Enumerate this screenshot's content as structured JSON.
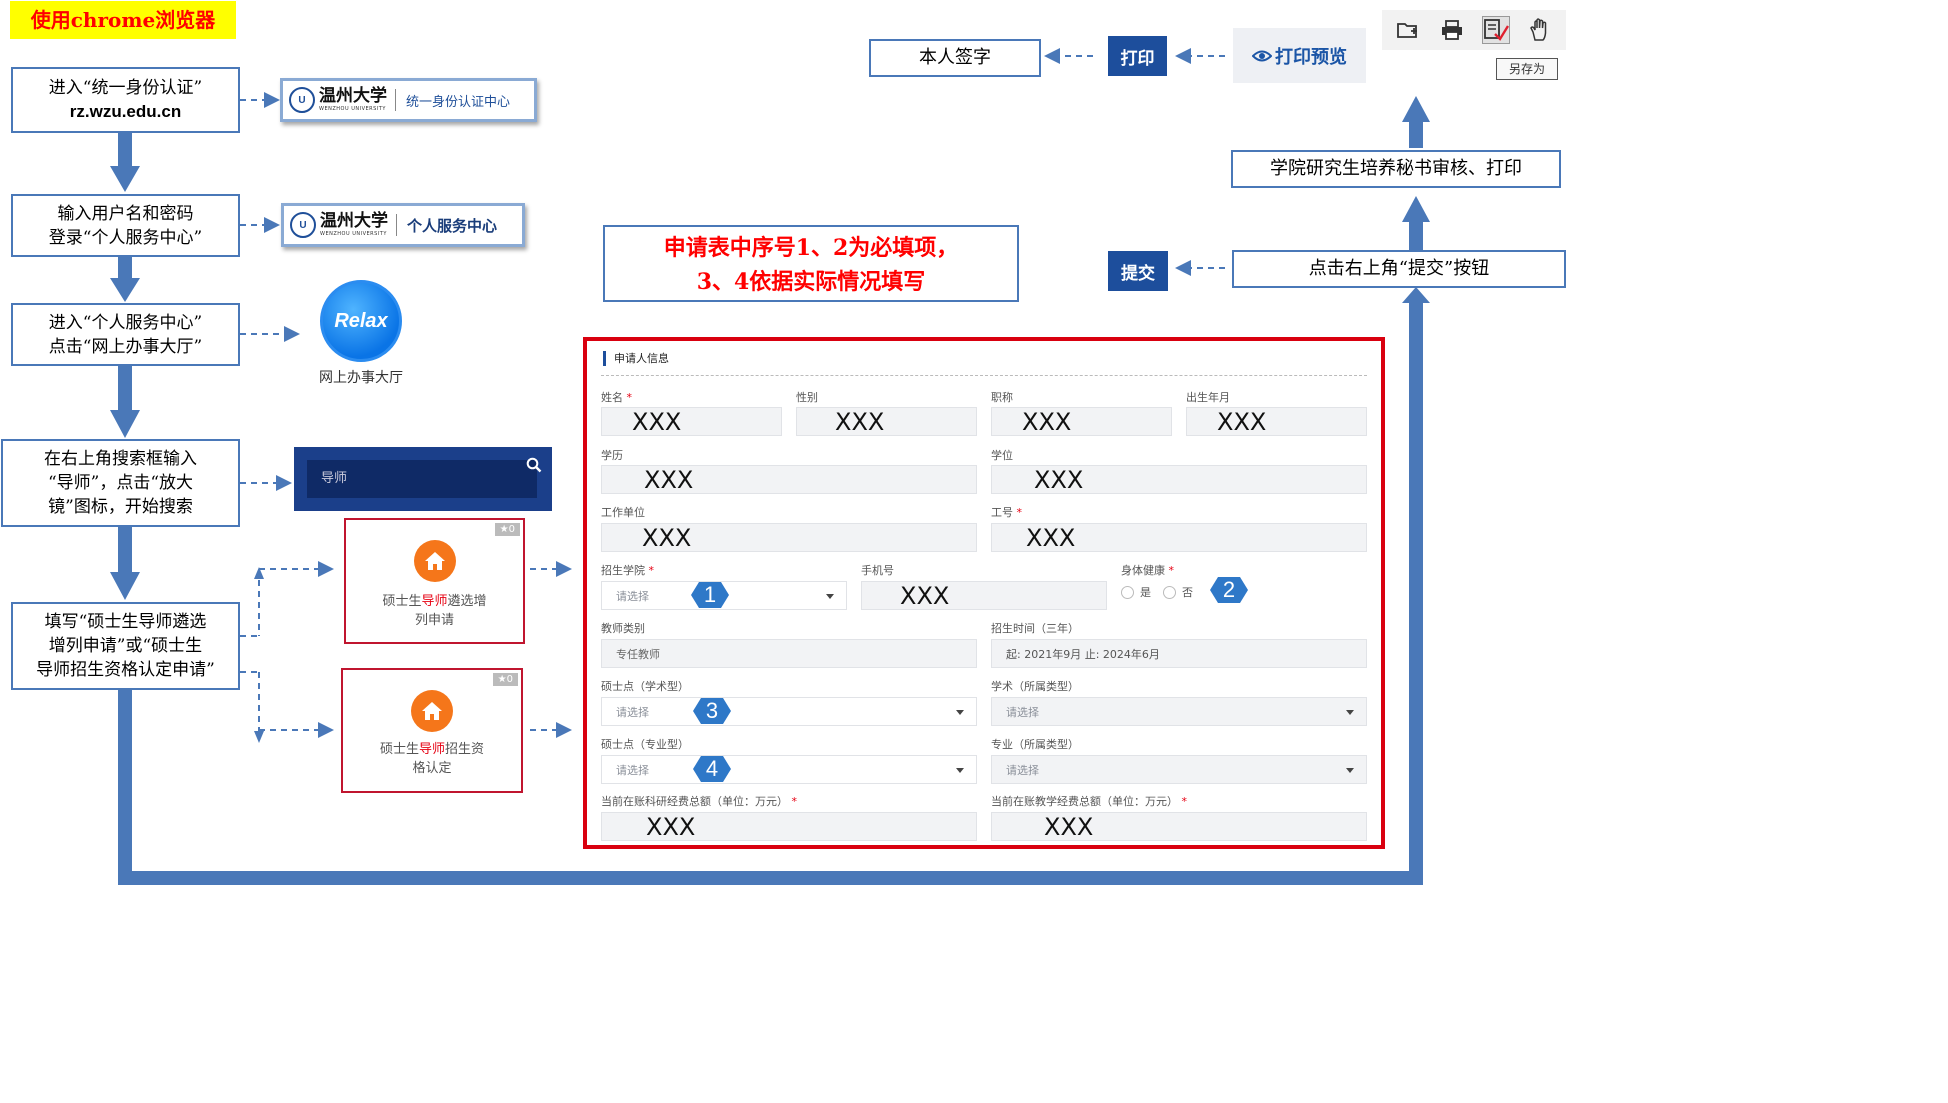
{
  "banner": "使用chrome浏览器",
  "steps": [
    {
      "line1": "进入“统一身份认证”",
      "line2": "rz.wzu.edu.cn"
    },
    {
      "line1": "输入用户名和密码",
      "line2": "登录“个人服务中心”"
    },
    {
      "line1": "进入“个人服务中心”",
      "line2": "点击“网上办事大厅”"
    },
    {
      "line1": "在右上角搜索框输入",
      "line2": "“导师”，点击“放大",
      "line3": "镜”图标，开始搜索"
    },
    {
      "line1": "填写“硕士生导师遴选",
      "line2": "增列申请”或“硕士生",
      "line3": "导师招生资格认定申请”"
    }
  ],
  "logos": {
    "seal_text": "U",
    "univ_cn": "温州大学",
    "univ_en": "WENZHOU UNIVERSITY",
    "bar1_service": "统一身份认证中心",
    "bar2_service": "个人服务中心"
  },
  "relax": {
    "logo_text": "Relax",
    "label": "网上办事大厅"
  },
  "search": {
    "query": "导师",
    "icon": "search-icon"
  },
  "cards": [
    {
      "count": "0",
      "pre": "硕士生",
      "hl": "导师",
      "post": "遴选增",
      "line2": "列申请"
    },
    {
      "count": "0",
      "pre": "硕士生",
      "hl": "导师",
      "post": "招生资",
      "line2": "格认定"
    }
  ],
  "note": {
    "line1": "申请表中序号1、2为必填项，",
    "line2": "3、4依据实际情况填写"
  },
  "right_flow": {
    "sign": "本人签字",
    "print": "打印",
    "preview": "打印预览",
    "saveas": "另存为",
    "secretary": "学院研究生培养秘书审核、打印",
    "submit": "提交",
    "click_submit": "点击右上角“提交”按钮"
  },
  "form": {
    "section_title": "申请人信息",
    "labels": {
      "name": "姓名",
      "gender": "性别",
      "title": "职称",
      "birth": "出生年月",
      "education": "学历",
      "degree": "学位",
      "workunit": "工作单位",
      "staffno": "工号",
      "college": "招生学院",
      "phone": "手机号",
      "health": "身体健康",
      "teacher_type": "教师类别",
      "enroll_time": "招生时间（三年）",
      "master_academic": "硕士点（学术型）",
      "academic_type": "学术（所属类型）",
      "master_prof": "硕士点（专业型）",
      "prof_type": "专业（所属类型）",
      "research_fund": "当前在账科研经费总额（单位：万元）",
      "teaching_fund": "当前在账教学经费总额（单位：万元）"
    },
    "placeholder_value": "XXX",
    "select_placeholder": "请选择",
    "health_yes": "是",
    "health_no": "否",
    "teacher_type_value": "专任教师",
    "enroll_time_value": "起: 2021年9月    止: 2024年6月",
    "badges": [
      "1",
      "2",
      "3",
      "4"
    ],
    "required_mark": "*"
  },
  "colors": {
    "flow_blue": "#4a78b8",
    "form_red": "#d9000f",
    "highlight": "#ffff00",
    "note_red": "#ff0000",
    "button_blue": "#1d4e9c"
  }
}
